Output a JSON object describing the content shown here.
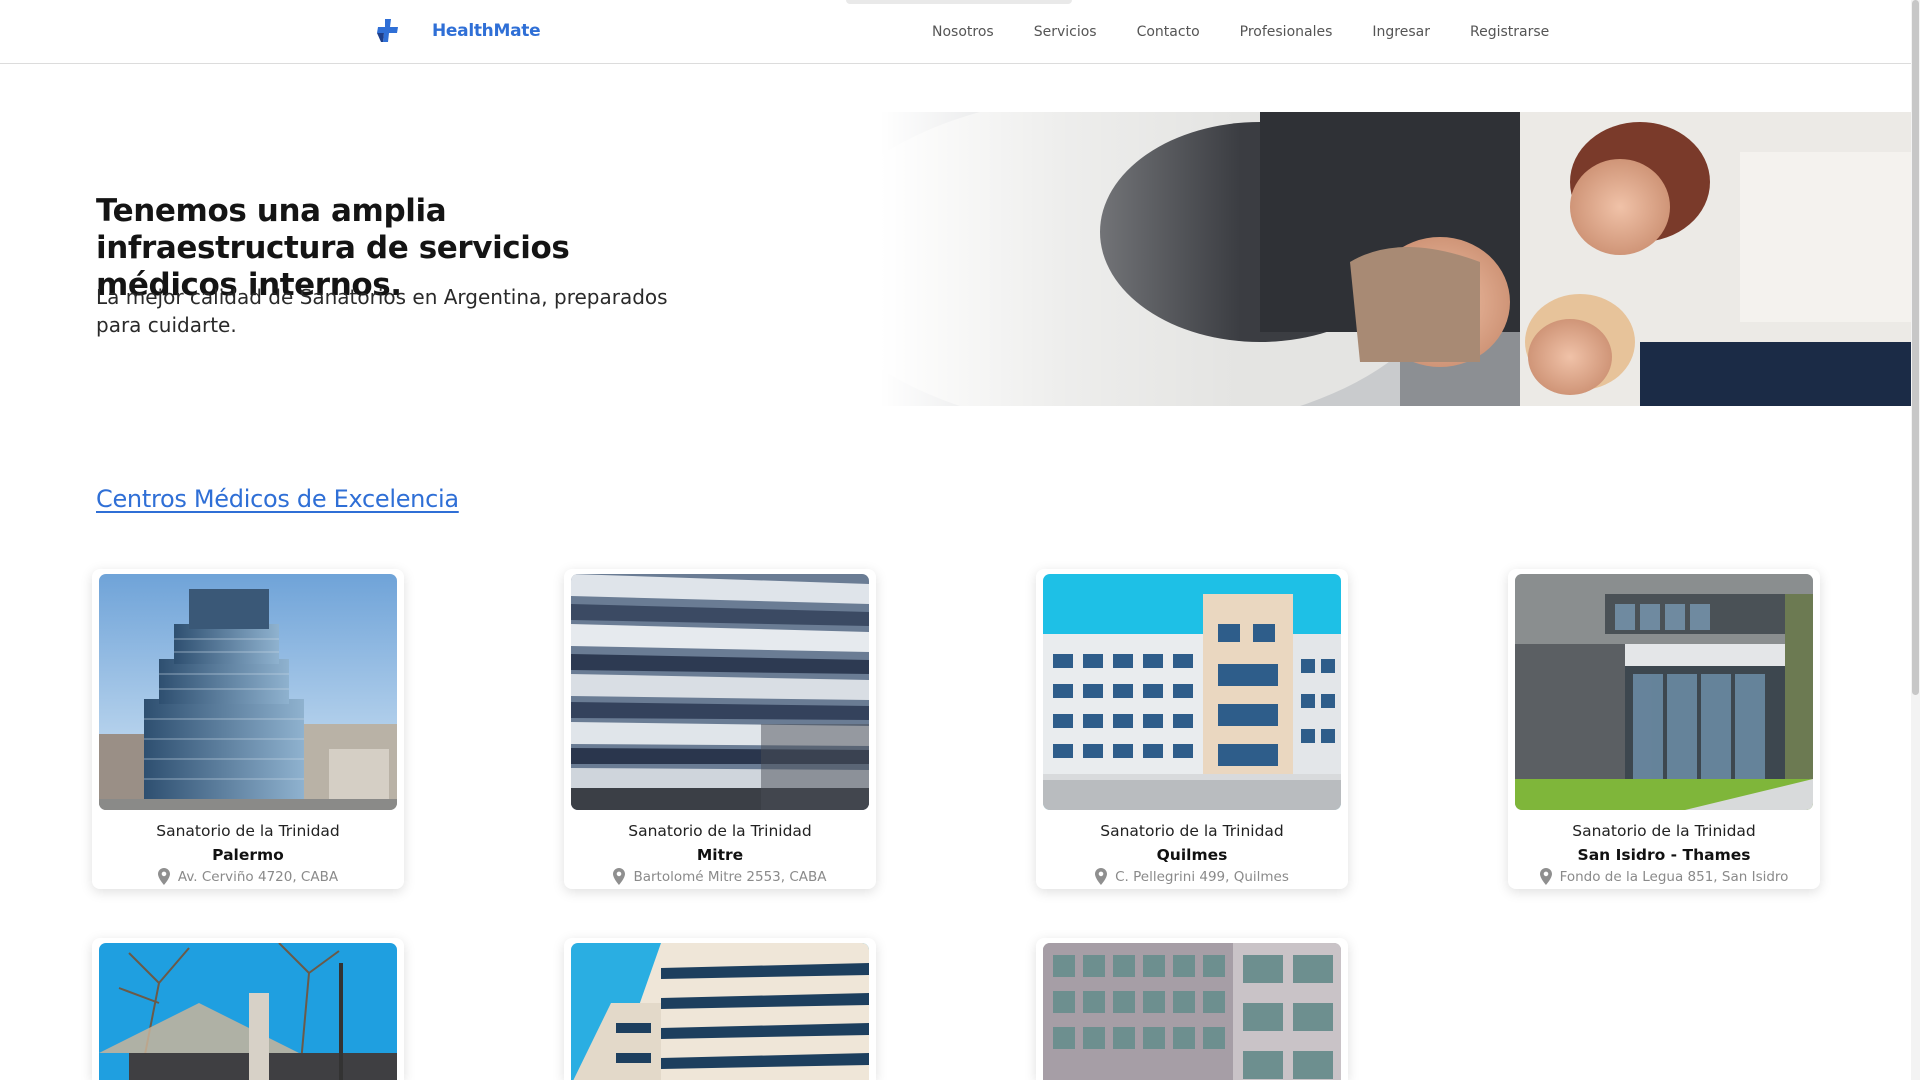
{
  "header": {
    "brand": "HealthMate",
    "nav": [
      {
        "label": "Nosotros"
      },
      {
        "label": "Servicios"
      },
      {
        "label": "Contacto"
      },
      {
        "label": "Profesionales"
      },
      {
        "label": "Ingresar"
      },
      {
        "label": "Registrarse"
      }
    ]
  },
  "hero": {
    "title": "Tenemos una amplia infraestructura de servicios médicos internos.",
    "subtitle": "La mejor calidad de Sanatorios en Argentina, preparados para cuidarte."
  },
  "section": {
    "title": "Centros Médicos de Excelencia"
  },
  "centers": [
    {
      "name": "Sanatorio de la Trinidad",
      "branch": "Palermo",
      "address": "Av. Cerviño 4720, CABA"
    },
    {
      "name": "Sanatorio de la Trinidad",
      "branch": "Mitre",
      "address": "Bartolomé Mitre 2553, CABA"
    },
    {
      "name": "Sanatorio de la Trinidad",
      "branch": "Quilmes",
      "address": "C. Pellegrini 499, Quilmes"
    },
    {
      "name": "Sanatorio de la Trinidad",
      "branch": "San Isidro - Thames",
      "address": "Fondo de la Legua 851, San Isidro"
    }
  ],
  "colors": {
    "brand": "#2f6fd6",
    "nav_text": "#555555",
    "address_text": "#8a8a8a"
  },
  "icons": [
    "medical-cross-logo-icon",
    "location-pin-icon"
  ]
}
